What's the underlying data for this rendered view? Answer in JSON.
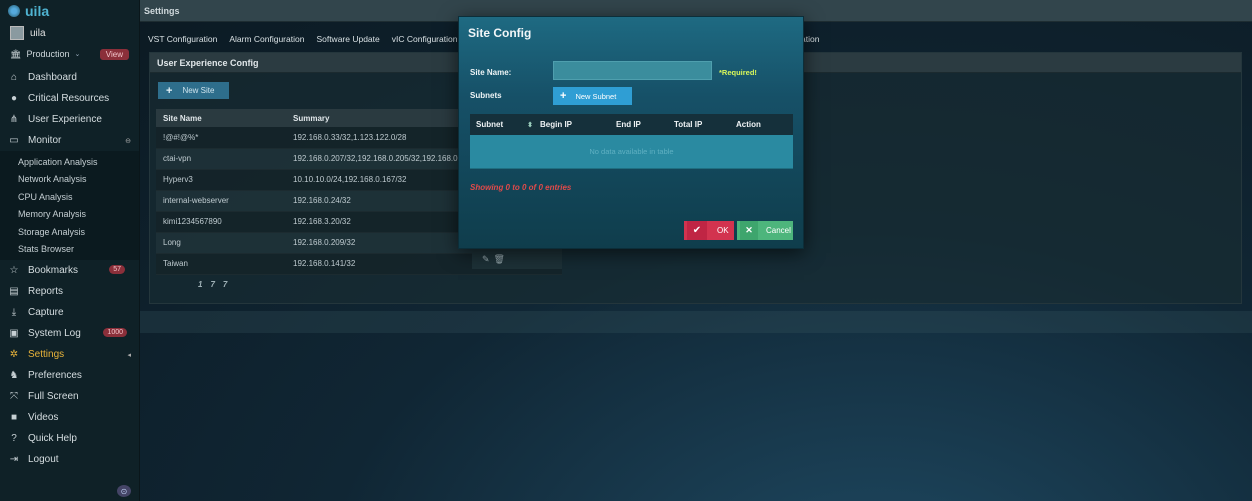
{
  "app": {
    "logo": "uila"
  },
  "user": {
    "name": "uila"
  },
  "environment": {
    "name": "Production",
    "view_label": "View"
  },
  "nav": {
    "items": [
      {
        "label": "Dashboard",
        "icon": "home-icon"
      },
      {
        "label": "Critical Resources",
        "icon": "pin-icon"
      },
      {
        "label": "User Experience",
        "icon": "sitemap-icon"
      },
      {
        "label": "Monitor",
        "icon": "monitor-icon"
      }
    ],
    "sub_items": [
      "Application Analysis",
      "Network Analysis",
      "CPU Analysis",
      "Memory Analysis",
      "Storage Analysis",
      "Stats Browser"
    ],
    "lower_items": [
      {
        "label": "Bookmarks",
        "icon": "star-icon",
        "badge": "57"
      },
      {
        "label": "Reports",
        "icon": "report-icon"
      },
      {
        "label": "Capture",
        "icon": "download-icon"
      },
      {
        "label": "System Log",
        "icon": "terminal-icon",
        "badge": "1000"
      },
      {
        "label": "Settings",
        "icon": "gear-icon"
      },
      {
        "label": "Preferences",
        "icon": "preferences-icon"
      },
      {
        "label": "Full Screen",
        "icon": "fullscreen-icon"
      },
      {
        "label": "Videos",
        "icon": "video-icon"
      },
      {
        "label": "Quick Help",
        "icon": "help-icon"
      },
      {
        "label": "Logout",
        "icon": "logout-icon"
      }
    ]
  },
  "header": {
    "title": "Settings"
  },
  "tabs": [
    "VST Configuration",
    "Alarm Configuration",
    "Software Update",
    "vIC Configuration",
    "S"
  ],
  "tabs_tail": "ation",
  "panel": {
    "title": "User Experience Config",
    "new_site_label": "New Site",
    "columns": [
      "Site Name",
      "Summary"
    ],
    "rows": [
      [
        "!@#!@%*",
        "192.168.0.33/32,1.123.122.0/28"
      ],
      [
        "ctai-vpn",
        "192.168.0.207/32,192.168.0.205/32,192.168.0.208/"
      ],
      [
        "Hyperv3",
        "10.10.10.0/24,192.168.0.167/32"
      ],
      [
        "internal-webserver",
        "192.168.0.24/32"
      ],
      [
        "kimi1234567890",
        "192.168.3.20/32"
      ],
      [
        "Long",
        "192.168.0.209/32"
      ],
      [
        "Taiwan",
        "192.168.0.141/32"
      ]
    ],
    "pager": [
      "1",
      "7",
      "7"
    ]
  },
  "modal": {
    "title": "Site Config",
    "site_name_label": "Site Name:",
    "site_name_value": "",
    "required_label": "*Required!",
    "subnets_label": "Subnets",
    "new_subnet_label": "New Subnet",
    "columns": [
      "Subnet",
      "Begin IP",
      "End IP",
      "Total IP",
      "Action"
    ],
    "empty_text": "No data available in table",
    "showing": "Showing 0 to 0 of 0 entries",
    "ok_label": "OK",
    "cancel_label": "Cancel"
  }
}
